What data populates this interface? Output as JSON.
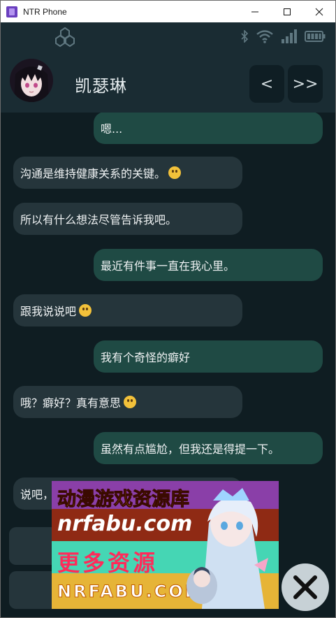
{
  "window": {
    "title": "NTR Phone"
  },
  "contact": {
    "name": "凯瑟琳"
  },
  "nav": {
    "prev_label": "<",
    "next_label": ">>"
  },
  "messages": [
    {
      "side": "out",
      "text": "嗯...",
      "emoji": ""
    },
    {
      "side": "in",
      "text": "沟通是维持健康关系的关键。",
      "emoji": "hugging-face"
    },
    {
      "side": "in",
      "text": "所以有什么想法尽管告诉我吧。",
      "emoji": ""
    },
    {
      "side": "out",
      "text": "最近有件事一直在我心里。",
      "emoji": ""
    },
    {
      "side": "in",
      "text": "跟我说说吧",
      "emoji": "slightly-smiling-face"
    },
    {
      "side": "out",
      "text": "我有个奇怪的癖好",
      "emoji": ""
    },
    {
      "side": "in",
      "text": "哦？癖好？真有意思",
      "emoji": "winking-face-with-tongue"
    },
    {
      "side": "out",
      "text": "虽然有点尴尬，但我还是得提一下。",
      "emoji": ""
    },
    {
      "side": "in",
      "text": "说吧，",
      "emoji": ""
    }
  ],
  "banner": {
    "line1": "动漫游戏资源库",
    "line2": "nrfabu.com",
    "line3": "更多资源",
    "line4": "NRFABU.COM"
  },
  "colors": {
    "background": "#0f1d22",
    "incoming_bubble": "#25353b",
    "outgoing_bubble": "#1f4a44",
    "header": "#1a2c33"
  }
}
